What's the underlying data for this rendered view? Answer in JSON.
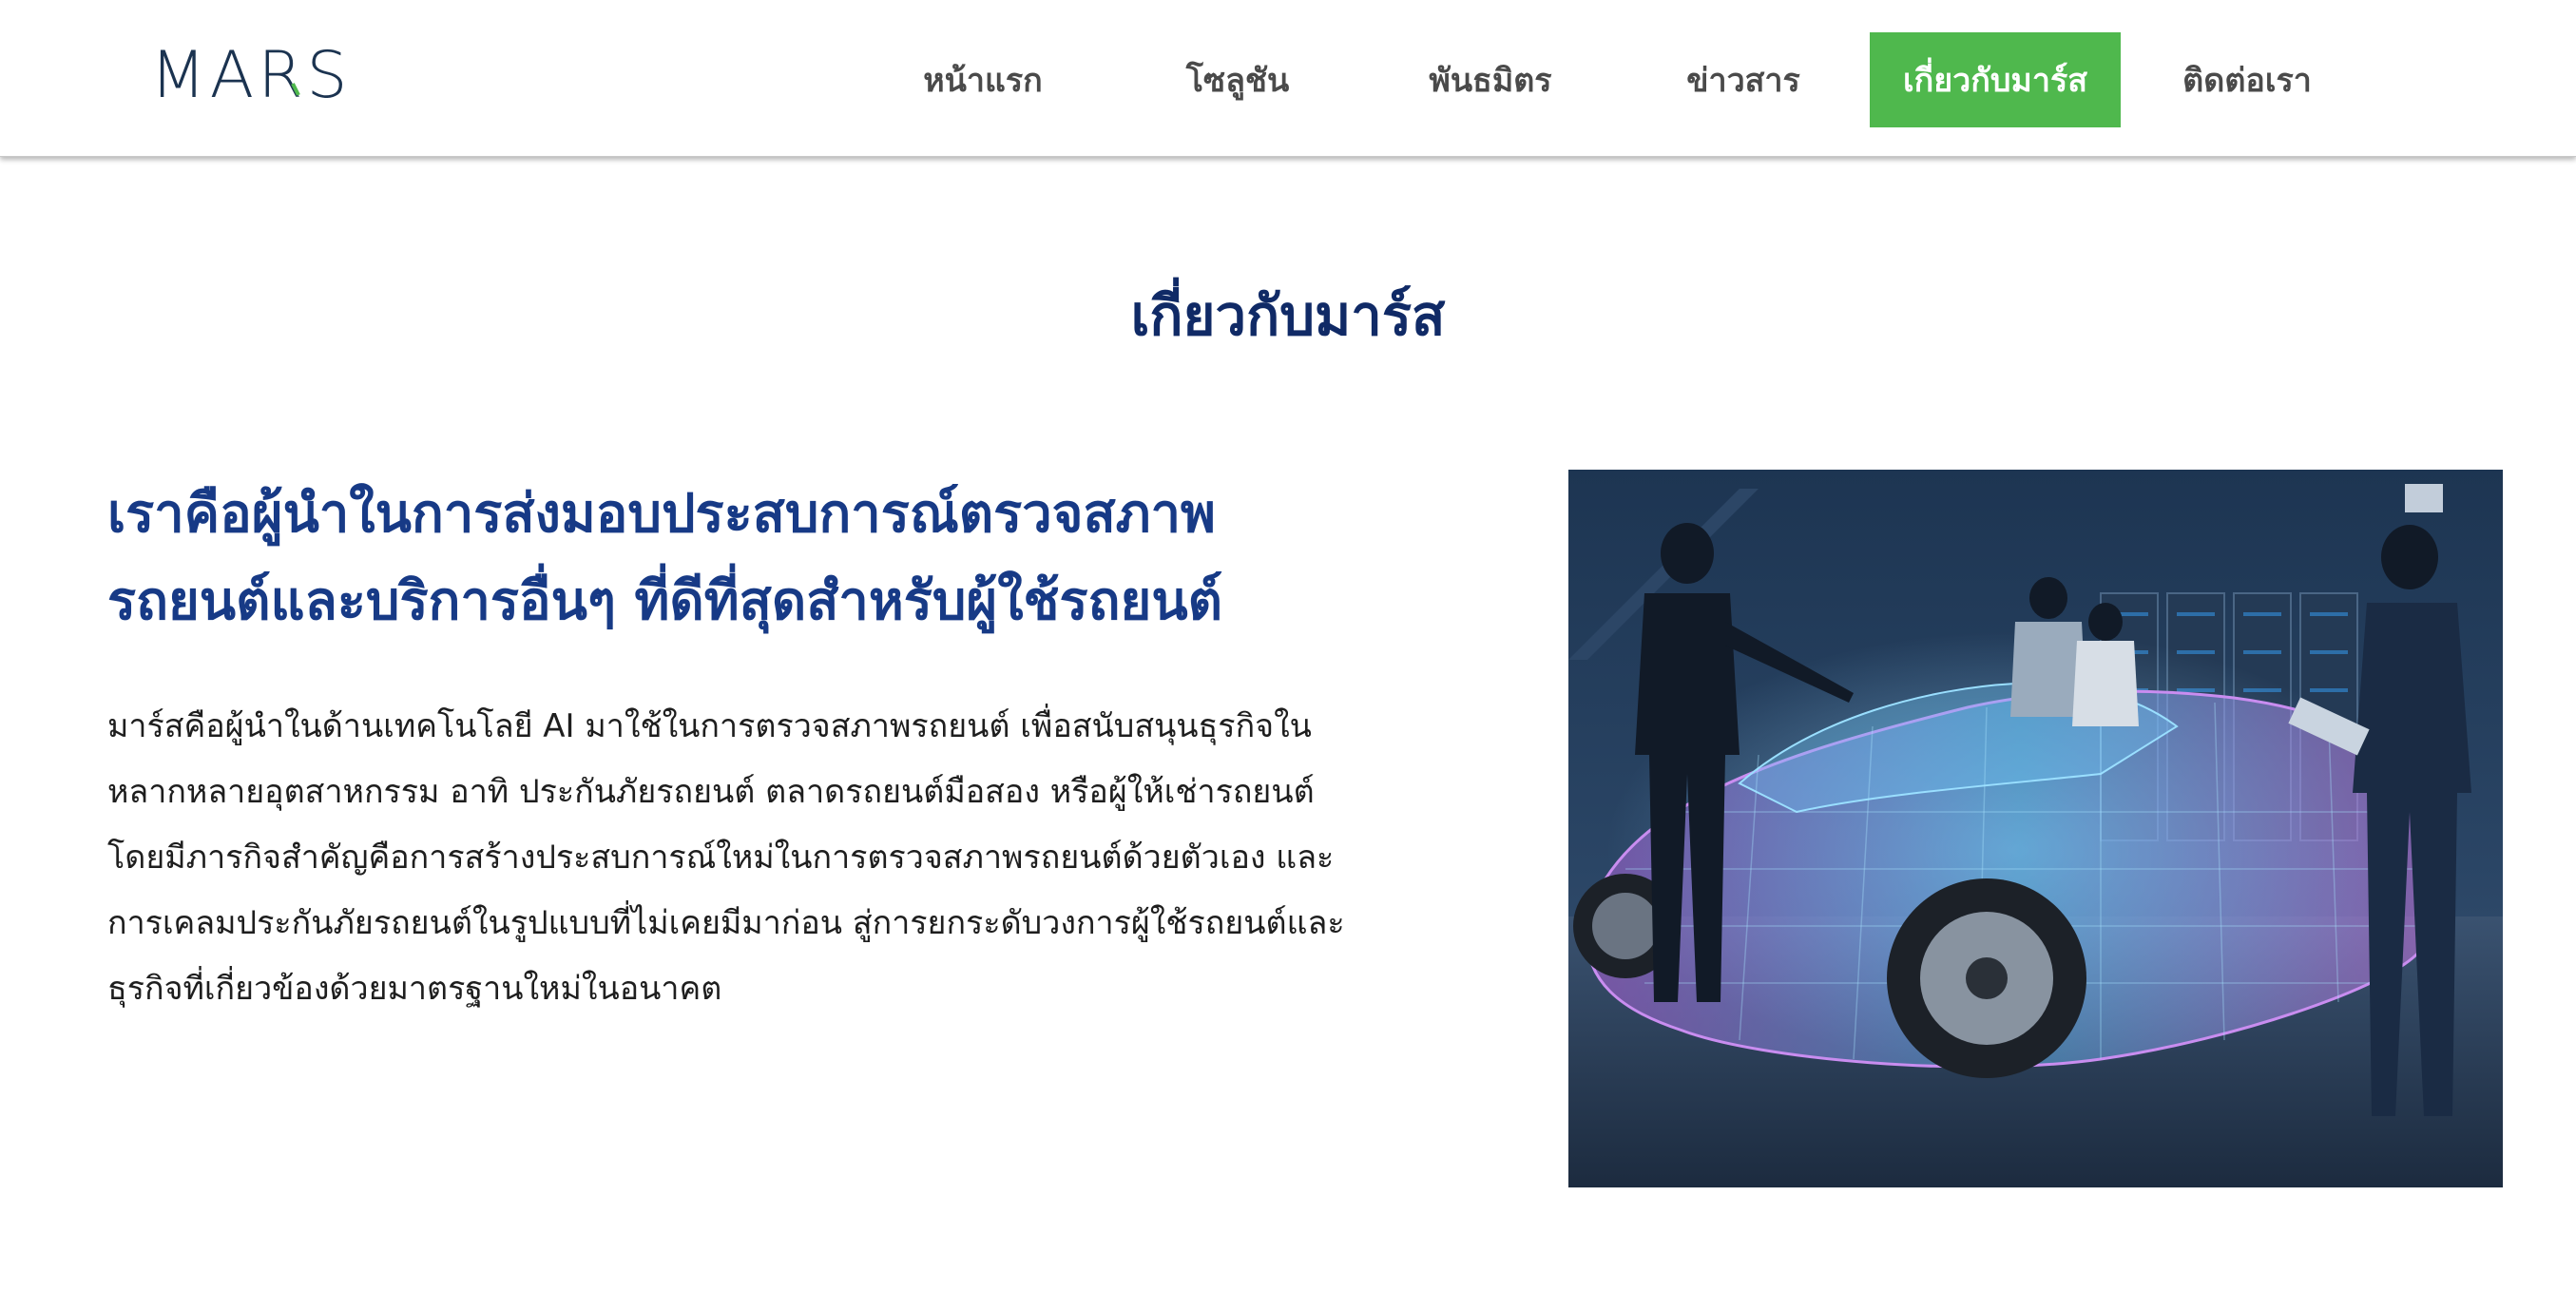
{
  "header": {
    "logo_text": "MARS",
    "nav": [
      {
        "label": "หน้าแรก"
      },
      {
        "label": "โซลูชัน"
      },
      {
        "label": "พันธมิตร"
      },
      {
        "label": "ข่าวสาร"
      },
      {
        "label": "เกี่ยวกับมาร์ส",
        "active": true
      },
      {
        "label": "ติดต่อเรา"
      }
    ]
  },
  "main": {
    "title": "เกี่ยวกับมาร์ส",
    "headline_lines": [
      "เราคือผู้นำในการส่งมอบประสบการณ์ตรวจสภาพ",
      "รถยนต์และบริการอื่นๆ ที่ดีที่สุดสำหรับผู้ใช้รถยนต์"
    ],
    "paragraph_lines": [
      "มาร์สคือผู้นำในด้านเทคโนโลยี AI มาใช้ในการตรวจสภาพรถยนต์ เพื่อสนับสนุนธุรกิจใน",
      "หลากหลายอุตสาหกรรม อาทิ ประกันภัยรถยนต์ ตลาดรถยนต์มือสอง หรือผู้ให้เช่ารถยนต์",
      "โดยมีภารกิจสำคัญคือการสร้างประสบการณ์ใหม่ในการตรวจสภาพรถยนต์ด้วยตัวเอง และ",
      "การเคลมประกันภัยรถยนต์ในรูปแบบที่ไม่เคยมีมาก่อน สู่การยกระดับวงการผู้ใช้รถยนต์และ",
      "ธุรกิจที่เกี่ยวข้องด้วยมาตรฐานใหม่ในอนาคต"
    ]
  },
  "colors": {
    "accent_green": "#4fb84d",
    "title_navy": "#102a66",
    "headline_blue": "#173a86",
    "logo_navy": "#1b3350",
    "nav_text": "#4a4a4a"
  },
  "icons": {
    "logo_mark": "green-tick-r"
  }
}
